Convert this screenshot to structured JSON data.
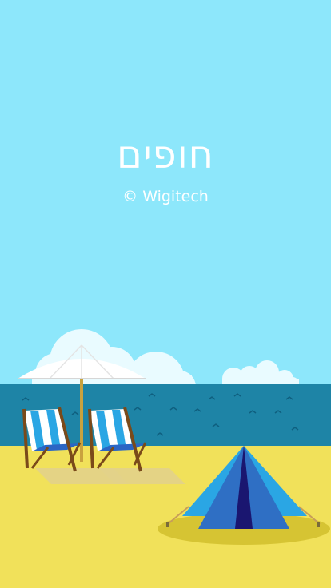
{
  "app": {
    "title": "חופים",
    "copyright": "© Wigitech"
  },
  "colors": {
    "sky": "#8de7fb",
    "sea": "#1e84a6",
    "sand": "#f1e15a",
    "tent": "#2f78c7",
    "umbrella": "#ffffff"
  },
  "icons": [
    "cloud-icon",
    "beach-umbrella-icon",
    "beach-chair-icon",
    "tent-icon",
    "wave-icon"
  ]
}
